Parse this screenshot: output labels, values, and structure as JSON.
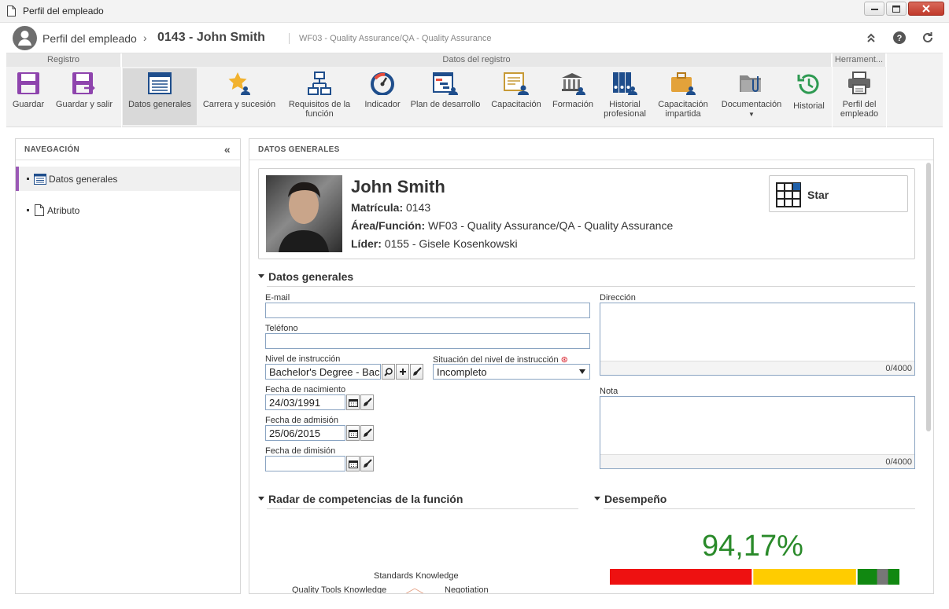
{
  "window": {
    "title": "Perfil del empleado"
  },
  "header": {
    "module": "Perfil del empleado",
    "record": "0143 - John Smith",
    "subtitle": "WF03 - Quality Assurance/QA - Quality Assurance"
  },
  "ribbon": {
    "groups": [
      "Registro",
      "Datos del registro",
      "Herrament..."
    ],
    "buttons": {
      "save": "Guardar",
      "save_exit": "Guardar y salir",
      "general": "Datos generales",
      "career": "Carrera y sucesión",
      "requirements_1": "Requisitos de la",
      "requirements_2": "función",
      "indicator": "Indicador",
      "devplan": "Plan de desarrollo",
      "training": "Capacitación",
      "education": "Formación",
      "history_1": "Historial",
      "history_2": "profesional",
      "given_1": "Capacitación",
      "given_2": "impartida",
      "docs": "Documentación",
      "historial": "Historial",
      "profile_1": "Perfil del",
      "profile_2": "empleado"
    }
  },
  "nav": {
    "title": "NAVEGACIÓN",
    "items": [
      "Datos generales",
      "Atributo"
    ]
  },
  "content": {
    "title": "DATOS GENERALES",
    "card": {
      "name": "John Smith",
      "id_label": "Matrícula:",
      "id_value": "0143",
      "area_label": "Área/Función:",
      "area_value": "WF03 - Quality Assurance/QA - Quality Assurance",
      "leader_label": "Líder:",
      "leader_value": "0155 - Gisele Kosenkowski",
      "star_label": "Star"
    },
    "section_general": "Datos generales",
    "fields": {
      "email_label": "E-mail",
      "email_value": "",
      "phone_label": "Teléfono",
      "phone_value": "",
      "education_label": "Nivel de instrucción",
      "education_value": "Bachelor's Degree - Bac",
      "edu_status_label": "Situación del nivel de instrucción",
      "edu_status_value": "Incompleto",
      "birth_label": "Fecha de nacimiento",
      "birth_value": "24/03/1991",
      "admission_label": "Fecha de admisión",
      "admission_value": "25/06/2015",
      "dismissal_label": "Fecha de dimisión",
      "dismissal_value": "",
      "address_label": "Dirección",
      "address_counter": "0/4000",
      "note_label": "Nota",
      "note_counter": "0/4000"
    },
    "section_radar": "Radar de competencias de la función",
    "radar_labels": [
      "Standards Knowledge",
      "Quality Tools Knowledge",
      "Negotiation"
    ],
    "section_performance": "Desempeño",
    "performance": {
      "value_text": "94,17%",
      "value": 94.17
    }
  },
  "colors": {
    "accent": "#9b59b6",
    "perf_green": "#2a8a2a",
    "bar_red": "#ee1111",
    "bar_yellow": "#ffcc00",
    "bar_green": "#118811"
  }
}
